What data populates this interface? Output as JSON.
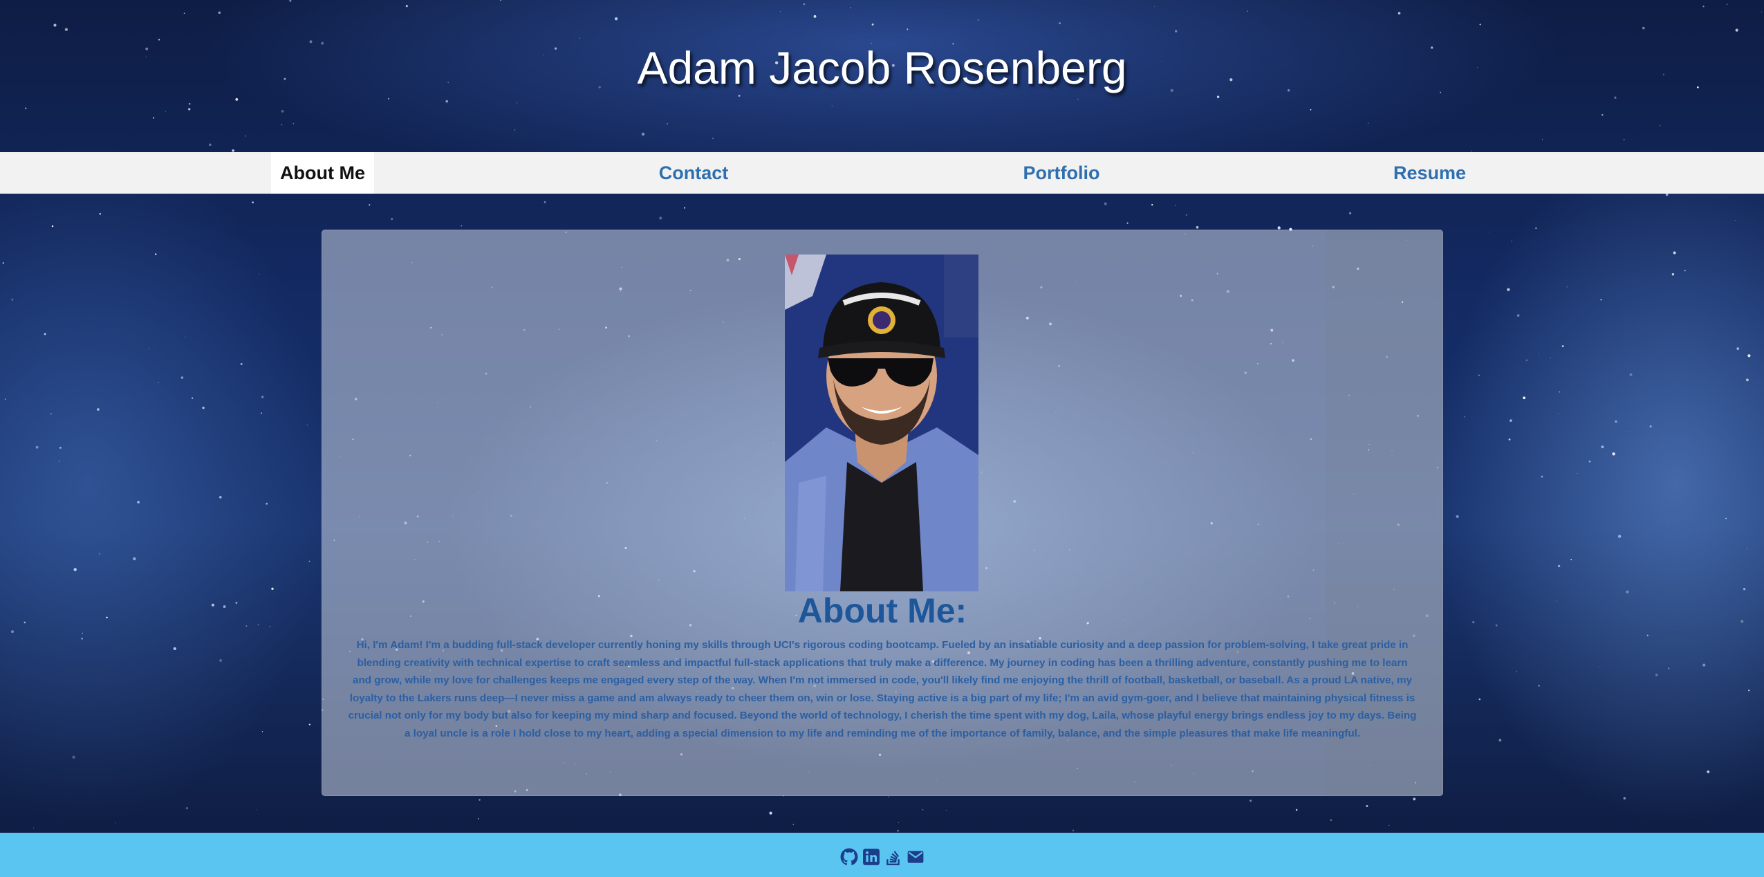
{
  "header": {
    "title": "Adam Jacob Rosenberg"
  },
  "nav": {
    "tabs": [
      {
        "label": "About Me",
        "active": true
      },
      {
        "label": "Contact",
        "active": false
      },
      {
        "label": "Portfolio",
        "active": false
      },
      {
        "label": "Resume",
        "active": false
      }
    ]
  },
  "about": {
    "heading": "About Me:",
    "photo_icon": "profile-photo",
    "body": "Hi, I'm Adam! I'm a budding full-stack developer currently honing my skills through UCI's rigorous coding bootcamp. Fueled by an insatiable curiosity and a deep passion for problem-solving, I take great pride in blending creativity with technical expertise to craft seamless and impactful full-stack applications that truly make a difference. My journey in coding has been a thrilling adventure, constantly pushing me to learn and grow, while my love for challenges keeps me engaged every step of the way. When I'm not immersed in code, you'll likely find me enjoying the thrill of football, basketball, or baseball. As a proud LA native, my loyalty to the Lakers runs deep—I never miss a game and am always ready to cheer them on, win or lose. Staying active is a big part of my life; I'm an avid gym-goer, and I believe that maintaining physical fitness is crucial not only for my body but also for keeping my mind sharp and focused. Beyond the world of technology, I cherish the time spent with my dog, Laila, whose playful energy brings endless joy to my days. Being a loyal uncle is a role I hold close to my heart, adding a special dimension to my life and reminding me of the importance of family, balance, and the simple pleasures that make life meaningful."
  },
  "footer": {
    "icons": [
      "github-icon",
      "linkedin-icon",
      "stackoverflow-icon",
      "email-icon"
    ]
  },
  "colors": {
    "nav_link": "#2f6fb0",
    "heading": "#1e5799",
    "footer_bg": "#5bc5f2",
    "nav_bg": "#f2f2f2"
  }
}
